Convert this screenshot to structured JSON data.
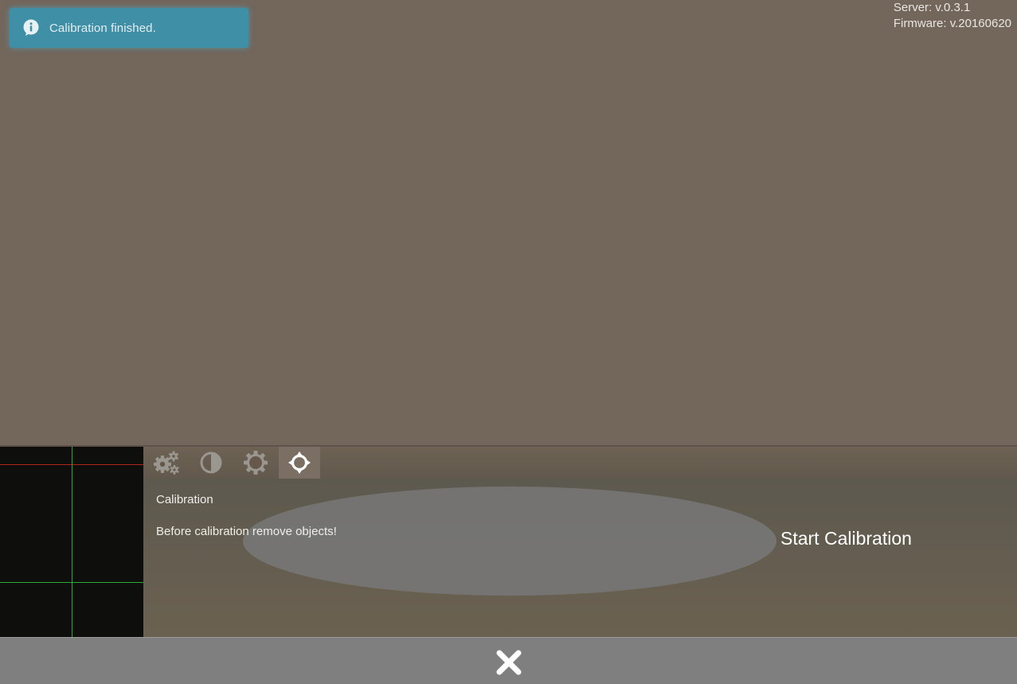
{
  "notification": {
    "message": "Calibration finished.",
    "icon": "info-icon",
    "color": "#3f8fa6"
  },
  "versions": {
    "server": "Server: v.0.3.1",
    "firmware": "Firmware: v.20160620"
  },
  "tabs": [
    {
      "icon": "gears-icon",
      "active": false
    },
    {
      "icon": "contrast-icon",
      "active": false
    },
    {
      "icon": "brightness-icon",
      "active": false
    },
    {
      "icon": "crosshair-icon",
      "active": true
    }
  ],
  "calibration": {
    "title": "Calibration",
    "description": "Before calibration remove objects!",
    "button_label": "Start Calibration"
  },
  "footer": {
    "close_icon": "close-icon"
  },
  "colors": {
    "background": "#73665b",
    "preview_bg": "#0e0f0c",
    "preview_red_line": "#b3231f",
    "preview_green_line": "#2ea83a",
    "footer_bg": "#7f7f7f"
  }
}
